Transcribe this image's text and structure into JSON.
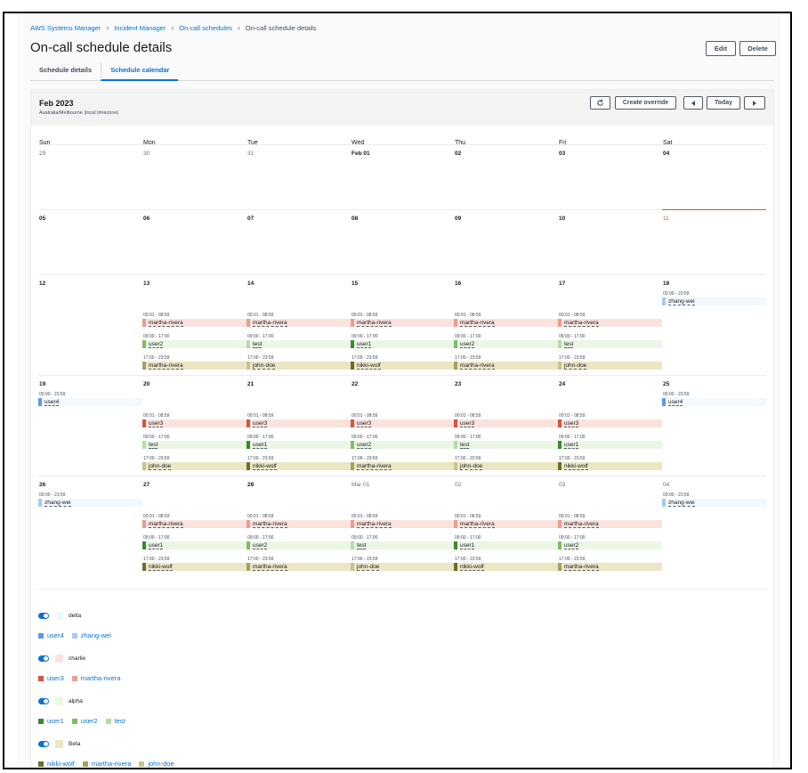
{
  "breadcrumb": [
    "AWS Systems Manager",
    "Incident Manager",
    "On-call schedules",
    "On-call schedule details"
  ],
  "page_title": "On-call schedule details",
  "header_buttons": {
    "edit": "Edit",
    "delete": "Delete"
  },
  "tabs": [
    {
      "label": "Schedule details",
      "active": false
    },
    {
      "label": "Schedule calendar",
      "active": true
    }
  ],
  "calendar": {
    "month": "Feb 2023",
    "timezone": "Australia/Melbourne (local timezone)",
    "buttons": {
      "refresh_icon": "refresh-icon",
      "create_override": "Create override",
      "prev_icon": "caret-left-icon",
      "today": "Today",
      "next_icon": "caret-right-icon"
    },
    "weekdays": [
      "Sun",
      "Mon",
      "Tue",
      "Wed",
      "Thu",
      "Fri",
      "Sat"
    ],
    "weeks": [
      {
        "days": [
          {
            "label": "29",
            "other": true
          },
          {
            "label": "30",
            "other": true
          },
          {
            "label": "31",
            "other": true
          },
          {
            "label": "Feb 01"
          },
          {
            "label": "02"
          },
          {
            "label": "03"
          },
          {
            "label": "04"
          }
        ]
      },
      {
        "days": [
          {
            "label": "05"
          },
          {
            "label": "06"
          },
          {
            "label": "07"
          },
          {
            "label": "08"
          },
          {
            "label": "09"
          },
          {
            "label": "10"
          },
          {
            "label": "11",
            "today": true
          }
        ]
      },
      {
        "days": [
          {
            "label": "12"
          },
          {
            "label": "13"
          },
          {
            "label": "14"
          },
          {
            "label": "15"
          },
          {
            "label": "16"
          },
          {
            "label": "17"
          },
          {
            "label": "18"
          }
        ],
        "weekend_shift": {
          "time": "00:00 - 23:59",
          "sun": null,
          "sat": "zhang-wei"
        },
        "weekday_shifts": [
          {
            "rotation": "charlie",
            "time": "00:01 - 08:59",
            "users": [
              "martha-rivera",
              "martha-rivera",
              "martha-rivera",
              "martha-rivera",
              "martha-rivera"
            ]
          },
          {
            "rotation": "alpha",
            "time": "09:00 - 17:00",
            "users": [
              "user2",
              "test",
              "user1",
              "user2",
              "test"
            ]
          },
          {
            "rotation": "Beta",
            "time": "17:00 - 23:59",
            "users": [
              "martha-rivera",
              "john-doe",
              "nikki-wolf",
              "martha-rivera",
              "john-doe"
            ]
          }
        ]
      },
      {
        "days": [
          {
            "label": "19"
          },
          {
            "label": "20"
          },
          {
            "label": "21"
          },
          {
            "label": "22"
          },
          {
            "label": "23"
          },
          {
            "label": "24"
          },
          {
            "label": "25"
          }
        ],
        "weekend_shift": {
          "time": "00:00 - 23:59",
          "sun": "user4",
          "sat": "user4"
        },
        "weekday_shifts": [
          {
            "rotation": "charlie",
            "time": "00:01 - 08:59",
            "users": [
              "user3",
              "user3",
              "user3",
              "user3",
              "user3"
            ]
          },
          {
            "rotation": "alpha",
            "time": "09:00 - 17:00",
            "users": [
              "test",
              "user1",
              "user2",
              "test",
              "user1"
            ]
          },
          {
            "rotation": "Beta",
            "time": "17:00 - 23:59",
            "users": [
              "john-doe",
              "nikki-wolf",
              "martha-rivera",
              "john-doe",
              "nikki-wolf"
            ]
          }
        ]
      },
      {
        "days": [
          {
            "label": "26"
          },
          {
            "label": "27"
          },
          {
            "label": "28"
          },
          {
            "label": "Mar 01",
            "other": true
          },
          {
            "label": "02",
            "other": true
          },
          {
            "label": "03",
            "other": true
          },
          {
            "label": "04",
            "other": true
          }
        ],
        "weekend_shift": {
          "time": "00:00 - 23:59",
          "sun": "zhang-wei",
          "sat": "zhang-wei"
        },
        "weekday_shifts": [
          {
            "rotation": "charlie",
            "time": "00:01 - 08:59",
            "users": [
              "martha-rivera",
              "martha-rivera",
              "martha-rivera",
              "martha-rivera",
              "martha-rivera"
            ]
          },
          {
            "rotation": "alpha",
            "time": "09:00 - 17:00",
            "users": [
              "user1",
              "user2",
              "test",
              "user1",
              "user2"
            ]
          },
          {
            "rotation": "Beta",
            "time": "17:00 - 23:59",
            "users": [
              "nikki-wolf",
              "martha-rivera",
              "john-doe",
              "nikki-wolf",
              "martha-rivera"
            ]
          }
        ]
      }
    ]
  },
  "legend": [
    {
      "name": "delta",
      "enabled": true,
      "bg": "#f1f8fe",
      "members": [
        {
          "name": "user4",
          "color": "#5c9be6"
        },
        {
          "name": "zhang-wei",
          "color": "#a9c9ef"
        }
      ]
    },
    {
      "name": "charlie",
      "enabled": true,
      "bg": "#fae3dd",
      "members": [
        {
          "name": "user3",
          "color": "#d2573f"
        },
        {
          "name": "martha-rivera",
          "color": "#ec9d8a"
        }
      ]
    },
    {
      "name": "alpha",
      "enabled": true,
      "bg": "#ebf6e5",
      "members": [
        {
          "name": "user1",
          "color": "#3c8a2f"
        },
        {
          "name": "user2",
          "color": "#7cbd65"
        },
        {
          "name": "test",
          "color": "#b6dca7"
        }
      ]
    },
    {
      "name": "Beta",
      "enabled": true,
      "bg": "#ebe6c4",
      "members": [
        {
          "name": "nikki-wolf",
          "color": "#6a7028"
        },
        {
          "name": "martha-rivera",
          "color": "#a2a35d"
        },
        {
          "name": "john-doe",
          "color": "#c9c28a"
        }
      ]
    }
  ],
  "colors": {
    "accent": "#0972d3",
    "today": "#d45b07"
  }
}
